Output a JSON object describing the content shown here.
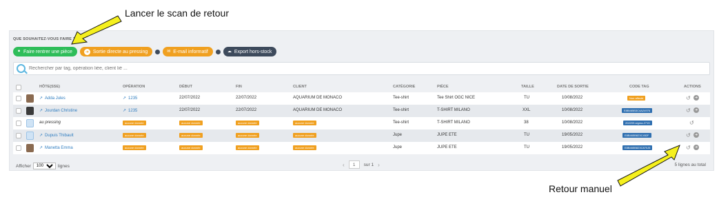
{
  "annotations": {
    "top": "Lancer le scan de retour",
    "bottom": "Retour manuel"
  },
  "panel": {
    "question": "QUE SOUHAITEZ-VOUS FAIRE ?",
    "buttons": {
      "return_item": "Faire rentrer une pièce",
      "direct_exit": "Sortie directe au pressing",
      "email": "E-mail informatif",
      "export": "Export hors-stock"
    }
  },
  "search": {
    "placeholder": "Rechercher par tag, opération liée, client lié ..."
  },
  "table": {
    "headers": [
      "HÔTE(SSE)",
      "OPÉRATION",
      "DÉBUT",
      "FIN",
      "CLIENT",
      "CATÉGORIE",
      "PIÈCE",
      "TAILLE",
      "DATE DE SORTIE",
      "CODE TAG",
      "ACTIONS"
    ],
    "rows": [
      {
        "host": "Adda Jules",
        "operation": "1235",
        "debut": "22/07/2022",
        "fin": "22/07/2022",
        "client": "AQUARIUM DE MONACO",
        "categorie": "Tee-shirt",
        "piece": "Tee Shirt OGC NICE",
        "taille": "TU",
        "date_sortie": "10/08/2022",
        "code_tag": "Non affecté"
      },
      {
        "host": "Jourdan Christine",
        "operation": "1235",
        "debut": "22/07/2022",
        "fin": "22/07/2022",
        "client": "AQUARIUM DE MONACO",
        "categorie": "Tee-shirt",
        "piece": "T-SHIRT MILANO",
        "taille": "XXL",
        "date_sortie": "10/08/2022",
        "code_tag": "E8B465B3C4A24976"
      },
      {
        "host": "au pressing",
        "operation": "aucune donnée",
        "debut": "aucune donnée",
        "fin": "aucune donnée",
        "client": "aucune donnée",
        "categorie": "Tee-shirt",
        "piece": "T-SHIRT MILANO",
        "taille": "38",
        "date_sortie": "10/08/2022",
        "code_tag": "202209-sigma-2715"
      },
      {
        "host": "Dupuis Thibault",
        "operation": "aucune donnée",
        "debut": "aucune donnée",
        "fin": "aucune donnée",
        "client": "aucune donnée",
        "categorie": "Jupe",
        "piece": "JUPE ETE",
        "taille": "TU",
        "date_sortie": "19/05/2022",
        "code_tag": "E8B465B823C452F"
      },
      {
        "host": "Manetta Emma",
        "operation": "aucune donnée",
        "debut": "aucune donnée",
        "fin": "aucune donnée",
        "client": "aucune donnée",
        "categorie": "Jupe",
        "piece": "JUPE ETE",
        "taille": "TU",
        "date_sortie": "19/05/2022",
        "code_tag": "E8B465B823C870J5"
      }
    ]
  },
  "footer": {
    "show_label": "Afficher",
    "page_size": "100",
    "lines_label": "lignes",
    "page": "1",
    "of_label": "sur 1",
    "total": "5 lignes au total"
  },
  "colors": {
    "green": "#2ebd59",
    "orange": "#f0a020",
    "dark": "#3d4a5c",
    "link": "#2f7dc0",
    "tag_blue": "#2f6fb0",
    "annotation_arrow": "#f5f01e"
  }
}
